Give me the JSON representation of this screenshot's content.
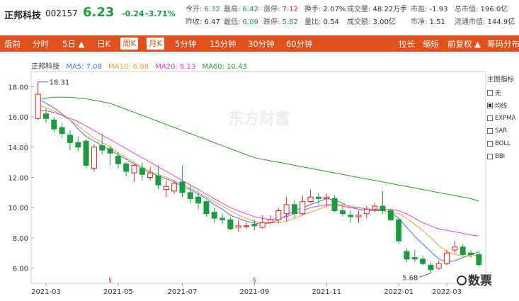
{
  "header": {
    "name": "正邦科技",
    "code": "002157",
    "price": "6.23",
    "change": "-0.24",
    "change_pct": "-3.71%",
    "stats_row1": [
      {
        "label": "今开:",
        "value": "6.32",
        "tone": "green"
      },
      {
        "label": "最高:",
        "value": "6.42",
        "tone": "green"
      },
      {
        "label": "涨停:",
        "value": "7.12",
        "tone": "red"
      },
      {
        "label": "换手:",
        "value": "2.07%",
        "tone": "plain"
      },
      {
        "label": "成交量:",
        "value": "48.22万手",
        "tone": "plain"
      },
      {
        "label": "市盈:",
        "value": "-1.93",
        "tone": "plain"
      },
      {
        "label": "总市值:",
        "value": "196.0亿",
        "tone": "plain"
      }
    ],
    "stats_row2": [
      {
        "label": "昨收:",
        "value": "6.47",
        "tone": "plain"
      },
      {
        "label": "最低:",
        "value": "6.09",
        "tone": "green"
      },
      {
        "label": "跌停:",
        "value": "5.82",
        "tone": "green"
      },
      {
        "label": "量比:",
        "value": "0.54",
        "tone": "plain"
      },
      {
        "label": "成交额:",
        "value": "3.00亿",
        "tone": "plain"
      },
      {
        "label": "市净:",
        "value": "1.51",
        "tone": "plain"
      },
      {
        "label": "流通市值:",
        "value": "144.9亿",
        "tone": "plain"
      }
    ]
  },
  "toolbar": {
    "left": [
      {
        "label": "盘前",
        "selected": false
      },
      {
        "label": "分时",
        "selected": false
      },
      {
        "label": "5日 ▲",
        "selected": false
      },
      {
        "label": "日K",
        "selected": false
      },
      {
        "label": "周K",
        "selected": true
      },
      {
        "label": "月K",
        "selected": true
      },
      {
        "label": "5分钟",
        "selected": false
      },
      {
        "label": "15分钟",
        "selected": false
      },
      {
        "label": "30分钟",
        "selected": false
      },
      {
        "label": "60分钟",
        "selected": false
      }
    ],
    "right": [
      {
        "label": "拉长"
      },
      {
        "label": "缩短"
      },
      {
        "label": "前复权 ▲"
      },
      {
        "label": "筹码分布"
      }
    ]
  },
  "legend": {
    "title": "正邦科技",
    "ma5": "MA5: 7.08",
    "ma10": "MA10: 6.88",
    "ma20": "MA20: 8.13",
    "ma60": "MA60: 10.43"
  },
  "side_panel": {
    "title": "主图指标",
    "items": [
      {
        "label": "无",
        "checked": false
      },
      {
        "label": "均线",
        "checked": true
      },
      {
        "label": "EXPMA",
        "checked": false
      },
      {
        "label": "SAR",
        "checked": false
      },
      {
        "label": "BOLL",
        "checked": false
      },
      {
        "label": "BBI",
        "checked": false
      }
    ]
  },
  "watermark": "东方财富",
  "logo_text": "数票",
  "colors": {
    "up": "#e02020",
    "down": "#1a9c3e",
    "ma5": "#3b7be8",
    "ma10": "#f0a030",
    "ma20": "#f040e0",
    "ma60": "#2a9a2a",
    "toolbar": "#e0501c"
  },
  "chart_data": {
    "type": "candlestick",
    "x_ticks": [
      "2021-03",
      "2021-05",
      "2021-07",
      "2021-09",
      "2021-11",
      "2022-01",
      "2022-03"
    ],
    "y_ticks": [
      "18.00",
      "16.00",
      "14.00",
      "12.00",
      "10.00",
      "8.00",
      "6.00"
    ],
    "ylim": [
      5.0,
      19.0
    ],
    "annotations": [
      {
        "text": "18.31",
        "x_index": 0,
        "value": 18.31
      },
      {
        "text": "5.68",
        "x_index": 49,
        "value": 5.68
      }
    ],
    "candles": [
      [
        15.9,
        17.5,
        18.31,
        15.8
      ],
      [
        16.2,
        15.9,
        16.6,
        15.6
      ],
      [
        15.8,
        15.2,
        16.0,
        15.0
      ],
      [
        15.3,
        14.9,
        15.6,
        14.6
      ],
      [
        14.8,
        14.3,
        15.1,
        13.8
      ],
      [
        14.3,
        14.0,
        14.7,
        13.7
      ],
      [
        14.4,
        12.8,
        14.5,
        12.6
      ],
      [
        12.6,
        14.0,
        14.2,
        12.4
      ],
      [
        14.1,
        13.8,
        14.9,
        13.5
      ],
      [
        13.9,
        13.6,
        14.1,
        12.8
      ],
      [
        13.4,
        12.9,
        13.7,
        12.6
      ],
      [
        12.9,
        12.4,
        13.0,
        12.1
      ],
      [
        12.3,
        12.8,
        12.9,
        11.7
      ],
      [
        12.6,
        12.2,
        13.0,
        11.8
      ],
      [
        12.0,
        12.3,
        12.7,
        11.8
      ],
      [
        12.1,
        11.5,
        12.8,
        11.2
      ],
      [
        11.2,
        11.4,
        11.8,
        10.7
      ],
      [
        11.1,
        11.6,
        11.8,
        10.9
      ],
      [
        11.7,
        11.0,
        12.8,
        10.7
      ],
      [
        11.0,
        10.6,
        11.5,
        10.3
      ],
      [
        10.7,
        10.3,
        11.0,
        9.9
      ],
      [
        10.4,
        9.6,
        10.5,
        9.4
      ],
      [
        9.7,
        9.3,
        10.0,
        9.0
      ],
      [
        9.3,
        9.2,
        9.6,
        8.9
      ],
      [
        9.2,
        8.6,
        9.4,
        8.5
      ],
      [
        8.7,
        8.8,
        9.2,
        8.4
      ],
      [
        8.8,
        8.8,
        9.0,
        8.6
      ],
      [
        8.9,
        8.8,
        9.2,
        8.5
      ],
      [
        8.7,
        9.0,
        9.5,
        8.6
      ],
      [
        9.0,
        9.2,
        9.5,
        8.9
      ],
      [
        9.2,
        9.8,
        10.0,
        9.0
      ],
      [
        9.6,
        10.2,
        10.7,
        9.1
      ],
      [
        10.2,
        9.6,
        10.5,
        9.3
      ],
      [
        9.6,
        10.4,
        10.8,
        9.5
      ],
      [
        10.4,
        10.7,
        11.2,
        10.3
      ],
      [
        10.7,
        10.6,
        11.0,
        10.2
      ],
      [
        10.6,
        10.7,
        10.9,
        10.1
      ],
      [
        10.6,
        9.8,
        10.8,
        9.7
      ],
      [
        9.8,
        9.6,
        10.2,
        9.4
      ],
      [
        9.5,
        9.4,
        9.8,
        9.0
      ],
      [
        9.4,
        9.5,
        9.8,
        9.0
      ],
      [
        9.6,
        9.9,
        10.1,
        9.3
      ],
      [
        9.9,
        10.1,
        10.3,
        9.7
      ],
      [
        10.1,
        9.8,
        11.1,
        9.6
      ],
      [
        9.8,
        9.2,
        9.9,
        9.1
      ],
      [
        9.2,
        7.8,
        9.3,
        7.6
      ],
      [
        7.1,
        6.6,
        7.3,
        6.4
      ],
      [
        6.7,
        6.6,
        7.2,
        6.4
      ],
      [
        6.6,
        6.3,
        6.8,
        6.2
      ],
      [
        6.2,
        5.9,
        6.4,
        5.68
      ],
      [
        6.0,
        6.3,
        6.5,
        5.9
      ],
      [
        6.3,
        7.0,
        7.2,
        6.2
      ],
      [
        7.2,
        7.4,
        7.8,
        7.0
      ],
      [
        7.4,
        6.9,
        7.6,
        6.8
      ],
      [
        7.0,
        6.9,
        7.2,
        6.7
      ],
      [
        6.9,
        6.23,
        7.1,
        6.09
      ]
    ],
    "ma_series": [
      {
        "name": "MA5",
        "values": [
          17.2,
          16.9,
          16.6,
          16.2,
          15.8,
          15.2,
          14.7,
          14.4,
          14.1,
          13.8,
          13.5,
          13.2,
          12.9,
          12.6,
          12.3,
          12.1,
          11.9,
          11.7,
          11.4,
          11.2,
          10.9,
          10.6,
          10.2,
          9.9,
          9.5,
          9.3,
          9.1,
          9.0,
          8.9,
          9.0,
          9.2,
          9.5,
          9.8,
          10.0,
          10.2,
          10.4,
          10.6,
          10.5,
          10.3,
          10.0,
          9.9,
          9.8,
          9.8,
          9.8,
          9.7,
          9.3,
          8.7,
          8.1,
          7.6,
          7.1,
          6.6,
          6.4,
          6.5,
          6.7,
          6.9,
          7.08
        ]
      },
      {
        "name": "MA10",
        "values": [
          16.8,
          16.6,
          16.4,
          16.1,
          15.8,
          15.4,
          15.0,
          14.6,
          14.3,
          14.0,
          13.6,
          13.3,
          13.0,
          12.7,
          12.4,
          12.2,
          12.0,
          11.8,
          11.5,
          11.3,
          11.0,
          10.7,
          10.4,
          10.1,
          9.8,
          9.5,
          9.3,
          9.1,
          9.0,
          9.0,
          9.0,
          9.1,
          9.3,
          9.5,
          9.7,
          9.9,
          10.1,
          10.2,
          10.2,
          10.1,
          10.0,
          9.9,
          9.9,
          9.8,
          9.7,
          9.6,
          9.3,
          8.9,
          8.5,
          8.0,
          7.5,
          7.1,
          6.9,
          6.8,
          6.8,
          6.88
        ]
      },
      {
        "name": "MA20",
        "values": [
          16.5,
          16.4,
          16.3,
          16.1,
          15.9,
          15.7,
          15.4,
          15.1,
          14.8,
          14.5,
          14.2,
          13.9,
          13.6,
          13.3,
          13.0,
          12.7,
          12.4,
          12.1,
          11.8,
          11.5,
          11.2,
          10.9,
          10.6,
          10.3,
          10.0,
          9.8,
          9.6,
          9.4,
          9.3,
          9.2,
          9.3,
          9.4,
          9.6,
          9.8,
          10.0,
          10.1,
          10.2,
          10.2,
          10.1,
          10.0,
          10.0,
          9.9,
          9.9,
          9.9,
          9.9,
          9.8,
          9.6,
          9.3,
          9.0,
          8.8,
          8.6,
          8.5,
          8.4,
          8.3,
          8.2,
          8.13
        ]
      },
      {
        "name": "MA60",
        "values": [
          17.2,
          17.25,
          17.3,
          17.3,
          17.3,
          17.25,
          17.2,
          17.1,
          17.0,
          16.9,
          16.7,
          16.5,
          16.3,
          16.1,
          15.9,
          15.7,
          15.5,
          15.3,
          15.1,
          14.9,
          14.7,
          14.5,
          14.3,
          14.1,
          13.9,
          13.7,
          13.5,
          13.3,
          13.2,
          13.1,
          13.0,
          12.9,
          12.8,
          12.7,
          12.6,
          12.5,
          12.4,
          12.3,
          12.2,
          12.1,
          12.0,
          11.9,
          11.8,
          11.7,
          11.6,
          11.5,
          11.4,
          11.3,
          11.2,
          11.1,
          11.0,
          10.9,
          10.8,
          10.7,
          10.6,
          10.43
        ]
      }
    ]
  }
}
